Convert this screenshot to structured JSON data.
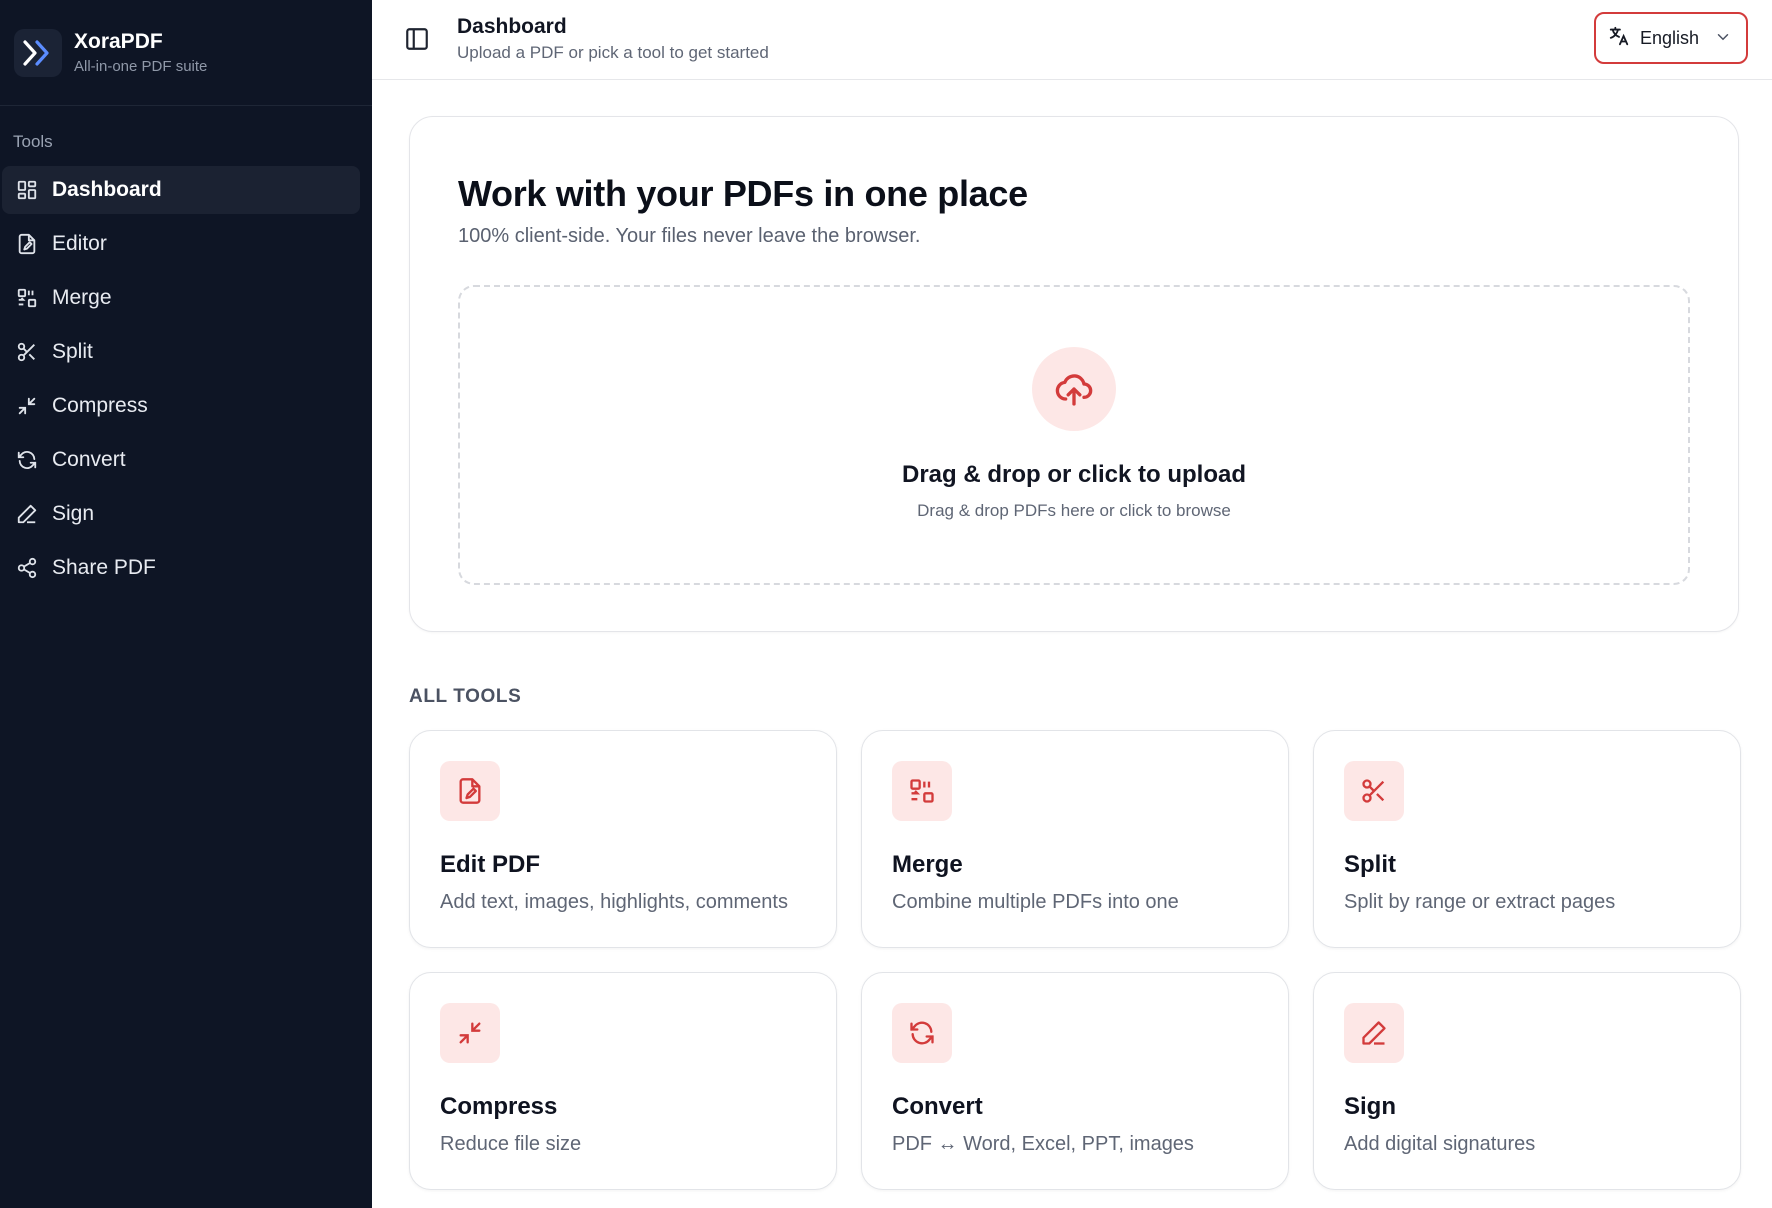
{
  "brand": {
    "name": "XoraPDF",
    "tagline": "All-in-one PDF suite",
    "logo_icon": "double-chevron-right-icon",
    "logo_color": "#5b8cff"
  },
  "sidebar": {
    "section_label": "Tools",
    "items": [
      {
        "label": "Dashboard",
        "icon": "dashboard-grid-icon",
        "active": true
      },
      {
        "label": "Editor",
        "icon": "file-edit-icon"
      },
      {
        "label": "Merge",
        "icon": "merge-icon"
      },
      {
        "label": "Split",
        "icon": "scissors-icon"
      },
      {
        "label": "Compress",
        "icon": "compress-arrows-icon"
      },
      {
        "label": "Convert",
        "icon": "refresh-icon"
      },
      {
        "label": "Sign",
        "icon": "pen-icon"
      },
      {
        "label": "Share PDF",
        "icon": "share-icon"
      }
    ]
  },
  "header": {
    "title": "Dashboard",
    "subtitle": "Upload a PDF or pick a tool to get started",
    "language": {
      "label": "English",
      "icon": "translate-icon"
    }
  },
  "hero": {
    "title": "Work with your PDFs in one place",
    "subtitle": "100% client-side. Your files never leave the browser.",
    "dropzone": {
      "title": "Drag & drop or click to upload",
      "subtitle": "Drag & drop PDFs here or click to browse",
      "icon": "cloud-upload-icon"
    }
  },
  "tools_section": {
    "label": "ALL TOOLS",
    "cards": [
      {
        "title": "Edit PDF",
        "description": "Add text, images, highlights, comments",
        "icon": "file-edit-icon"
      },
      {
        "title": "Merge",
        "description": "Combine multiple PDFs into one",
        "icon": "merge-icon"
      },
      {
        "title": "Split",
        "description": "Split by range or extract pages",
        "icon": "scissors-icon"
      },
      {
        "title": "Compress",
        "description": "Reduce file size",
        "icon": "compress-arrows-icon"
      },
      {
        "title": "Convert",
        "description": "PDF ↔ Word, Excel, PPT, images",
        "icon": "refresh-icon"
      },
      {
        "title": "Sign",
        "description": "Add digital signatures",
        "icon": "pen-icon"
      }
    ]
  },
  "colors": {
    "sidebar_bg": "#0e1525",
    "accent": "#d33b3b",
    "accent_soft": "#fde7e6"
  }
}
